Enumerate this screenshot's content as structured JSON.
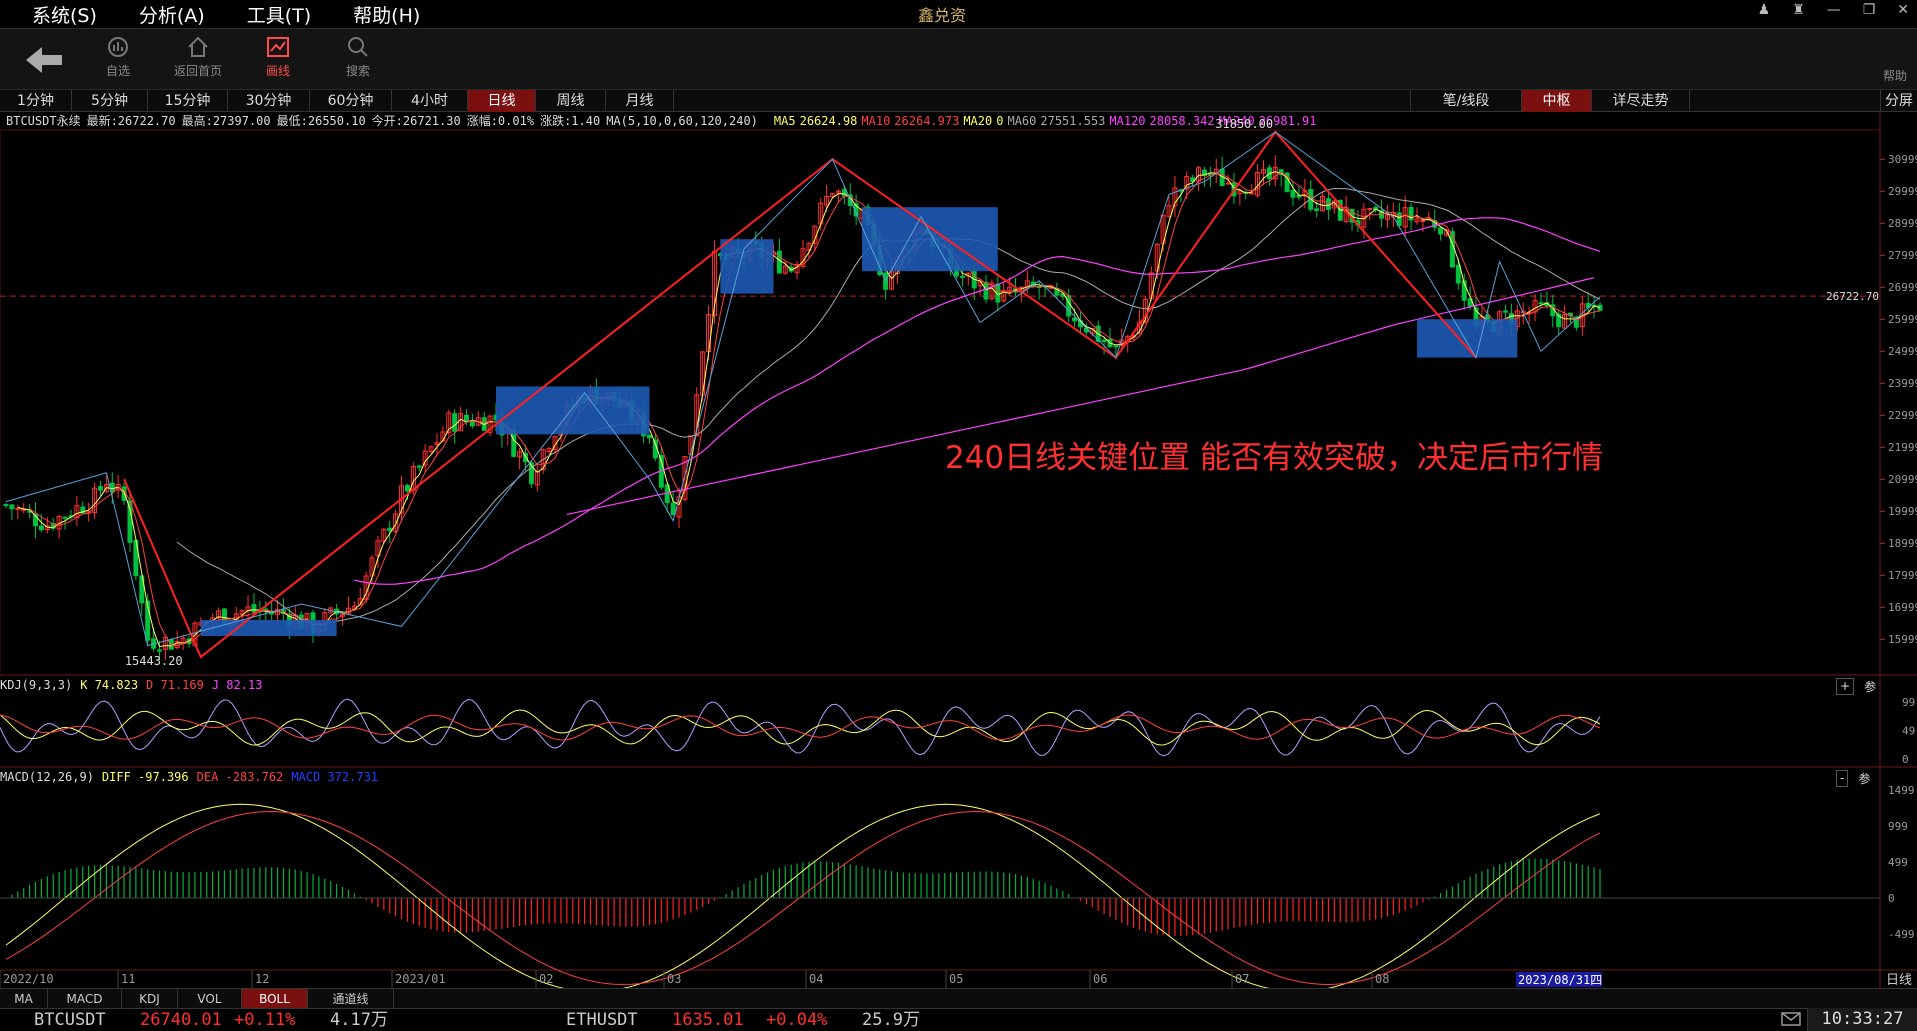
{
  "menu": {
    "items": [
      "系统(S)",
      "分析(A)",
      "工具(T)",
      "帮助(H)"
    ]
  },
  "app": {
    "logo": "鑫兑资"
  },
  "toolbar": {
    "items": [
      {
        "label": "自选",
        "icon": "star-circle-icon"
      },
      {
        "label": "返回首页",
        "icon": "home-icon"
      },
      {
        "label": "画线",
        "icon": "draw-line-icon"
      },
      {
        "label": "搜索",
        "icon": "search-icon"
      }
    ],
    "active": "画线",
    "help": "帮助"
  },
  "periods": {
    "items": [
      "1分钟",
      "5分钟",
      "15分钟",
      "30分钟",
      "60分钟",
      "4小时",
      "日线",
      "周线",
      "月线"
    ],
    "active": "日线",
    "right_items": [
      "笔/线段",
      "中枢",
      "详尽走势"
    ],
    "right_active": "中枢",
    "split": "分屏"
  },
  "quote": {
    "symbol": "BTCUSDT永续",
    "latest": "最新:26722.70",
    "high": "最高:27397.00",
    "low": "最低:26550.10",
    "open": "今开:26721.30",
    "change_pct": "涨幅:0.01%",
    "change": "涨跌:1.40",
    "ma_params": "MA(5,10,0,60,120,240)",
    "ma": [
      {
        "label": "MA5",
        "value": "26624.98",
        "color": "#ffff60"
      },
      {
        "label": "MA10",
        "value": "26264.973",
        "color": "#ff4040"
      },
      {
        "label": "MA20",
        "value": "0",
        "color": "#ffff60"
      },
      {
        "label": "MA60",
        "value": "27551.553",
        "color": "#aaaaaa"
      },
      {
        "label": "MA120",
        "value": "28058.342",
        "color": "#ff40ff"
      },
      {
        "label": "MA240",
        "value": "26981.91",
        "color": "#ff40ff"
      }
    ]
  },
  "price_axis": {
    "ticks": [
      "30999",
      "29999",
      "28999",
      "27999",
      "26999",
      "25999",
      "24999",
      "23999",
      "22999",
      "21999",
      "20999",
      "19999",
      "18999",
      "17999",
      "16999",
      "15999"
    ],
    "current": "26722.70"
  },
  "price_marks": {
    "high": "31850.00",
    "low": "15443.20"
  },
  "annotation": "240日线关键位置 能否有效突破，决定后市行情",
  "kdj": {
    "name": "KDJ(9,3,3)",
    "k": "K 74.823",
    "d": "D 71.169",
    "j": "J 82.13",
    "ticks": [
      "99",
      "49",
      "0"
    ],
    "btn_plus": "+",
    "btn_param": "参"
  },
  "macd": {
    "name": "MACD(12,26,9)",
    "diff": "DIFF -97.396",
    "dea": "DEA -283.762",
    "macd": "MACD 372.731",
    "ticks": [
      "1499",
      "999",
      "499",
      "0",
      "-499"
    ],
    "btn_minus": "-",
    "btn_param": "参"
  },
  "time_axis": {
    "labels": [
      "2022/10",
      "11",
      "12",
      "2023/01",
      "02",
      "03",
      "04",
      "05",
      "06",
      "07",
      "08"
    ],
    "cursor": "2023/08/31四",
    "unit": "日线"
  },
  "bottom_tabs": {
    "items": [
      "MA",
      "MACD",
      "KDJ",
      "VOL",
      "BOLL",
      "通道线"
    ],
    "active": "BOLL"
  },
  "status": {
    "q1": {
      "symbol": "BTCUSDT",
      "price": "26740.01",
      "pct": "+0.11%",
      "vol": "4.17万"
    },
    "q2": {
      "symbol": "ETHUSDT",
      "price": "1635.01",
      "pct": "+0.04%",
      "vol": "25.9万"
    },
    "clock": "10:33:27"
  },
  "colors": {
    "up": "#ff3030",
    "down": "#00c8c8",
    "ma5": "#ffff60",
    "ma10": "#ff4040",
    "ma60": "#aaaaaa",
    "ma120": "#ff40ff",
    "zs": "#1e5ab4"
  },
  "chart_data": {
    "type": "candlestick",
    "symbol": "BTCUSDT永续",
    "period": "日线",
    "x_range": [
      "2022/10",
      "2023/08/31"
    ],
    "y_range": [
      15443.2,
      31850.0
    ],
    "swing_points": [
      {
        "date": "2022/10",
        "price": 20000
      },
      {
        "date": "2022/11",
        "price": 21400
      },
      {
        "date": "2022/12",
        "price": 15443.2
      },
      {
        "date": "2023/02",
        "price": 25200
      },
      {
        "date": "2023/03",
        "price": 19500
      },
      {
        "date": "2023/04",
        "price": 30999
      },
      {
        "date": "2023/06",
        "price": 24800
      },
      {
        "date": "2023/07",
        "price": 31850.0
      },
      {
        "date": "2023/08",
        "price": 25200
      },
      {
        "date": "2023/08/31",
        "price": 26722.7
      }
    ]
  }
}
